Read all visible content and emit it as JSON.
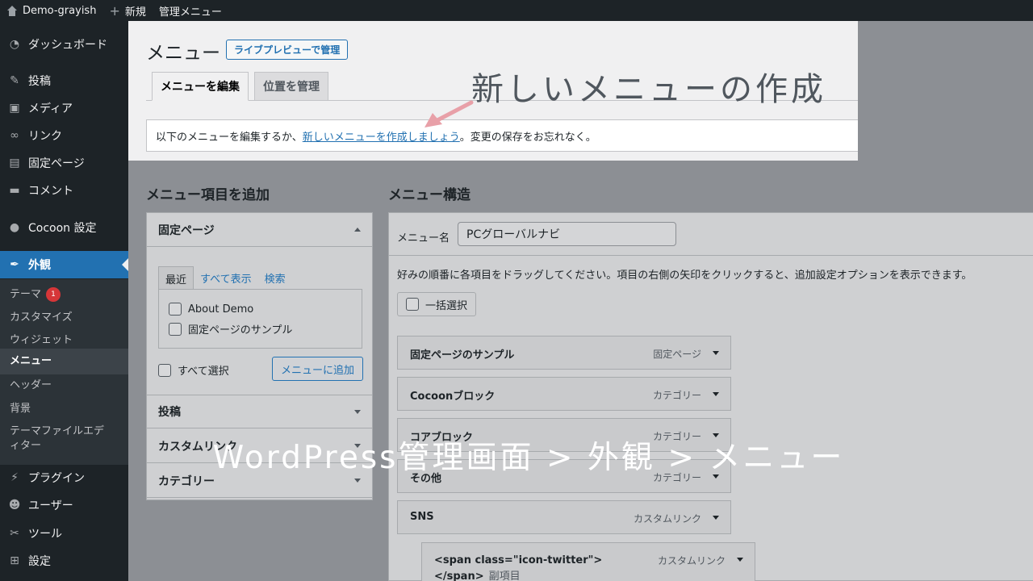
{
  "adminbar": {
    "site_name": "Demo-grayish",
    "new_label": "新規",
    "admin_menu_label": "管理メニュー"
  },
  "sidebar": {
    "items": [
      {
        "label": "ダッシュボード",
        "icon": "dashboard-icon"
      },
      {
        "label": "投稿",
        "icon": "pin-icon"
      },
      {
        "label": "メディア",
        "icon": "media-icon"
      },
      {
        "label": "リンク",
        "icon": "link-icon"
      },
      {
        "label": "固定ページ",
        "icon": "page-icon"
      },
      {
        "label": "コメント",
        "icon": "comment-icon"
      },
      {
        "label": "Cocoon 設定",
        "icon": "cocoon-icon"
      },
      {
        "label": "外観",
        "icon": "appearance-icon"
      },
      {
        "label": "プラグイン",
        "icon": "plugin-icon"
      },
      {
        "label": "ユーザー",
        "icon": "user-icon"
      },
      {
        "label": "ツール",
        "icon": "wrench-icon"
      },
      {
        "label": "設定",
        "icon": "settings-icon"
      }
    ],
    "submenu": [
      {
        "label": "テーマ",
        "badge": "1"
      },
      {
        "label": "カスタマイズ"
      },
      {
        "label": "ウィジェット"
      },
      {
        "label": "メニュー"
      },
      {
        "label": "ヘッダー"
      },
      {
        "label": "背景"
      },
      {
        "label": "テーマファイルエディター"
      }
    ]
  },
  "header": {
    "title": "メニュー",
    "preview_button": "ライブプレビューで管理",
    "tabs": [
      {
        "label": "メニューを編集"
      },
      {
        "label": "位置を管理"
      }
    ]
  },
  "notice": {
    "before": "以下のメニューを編集するか、",
    "link": "新しいメニューを作成しましょう",
    "after": "。変更の保存をお忘れなく。"
  },
  "add_items": {
    "title": "メニュー項目を追加",
    "panel_title": "固定ページ",
    "mini_tabs": [
      "最近",
      "すべて表示",
      "検索"
    ],
    "pages": [
      "About Demo",
      "固定ページのサンプル"
    ],
    "select_all": "すべて選択",
    "add_button": "メニューに追加",
    "other_panels": [
      "投稿",
      "カスタムリンク",
      "カテゴリー"
    ]
  },
  "structure": {
    "title": "メニュー構造",
    "name_label": "メニュー名",
    "name_value": "PCグローバルナビ",
    "instructions": "好みの順番に各項目をドラッグしてください。項目の右側の矢印をクリックすると、追加設定オプションを表示できます。",
    "bulk_select": "一括選択",
    "items": [
      {
        "title": "固定ページのサンプル",
        "type": "固定ページ"
      },
      {
        "title": "Cocoonブロック",
        "type": "カテゴリー"
      },
      {
        "title": "コアブロック",
        "type": "カテゴリー"
      },
      {
        "title": "その他",
        "type": "カテゴリー"
      },
      {
        "title": "SNS",
        "type": "カスタムリンク"
      }
    ],
    "sub_item": {
      "title_line1": "<span class=\"icon-twitter\">",
      "title_line2": "</span>",
      "sub_label": "副項目",
      "type": "カスタムリンク"
    }
  },
  "annotations": {
    "heading": "新しいメニューの作成",
    "caption": "WordPress管理画面 > 外観 > メニュー",
    "arrow_color": "#e8a0a8"
  }
}
